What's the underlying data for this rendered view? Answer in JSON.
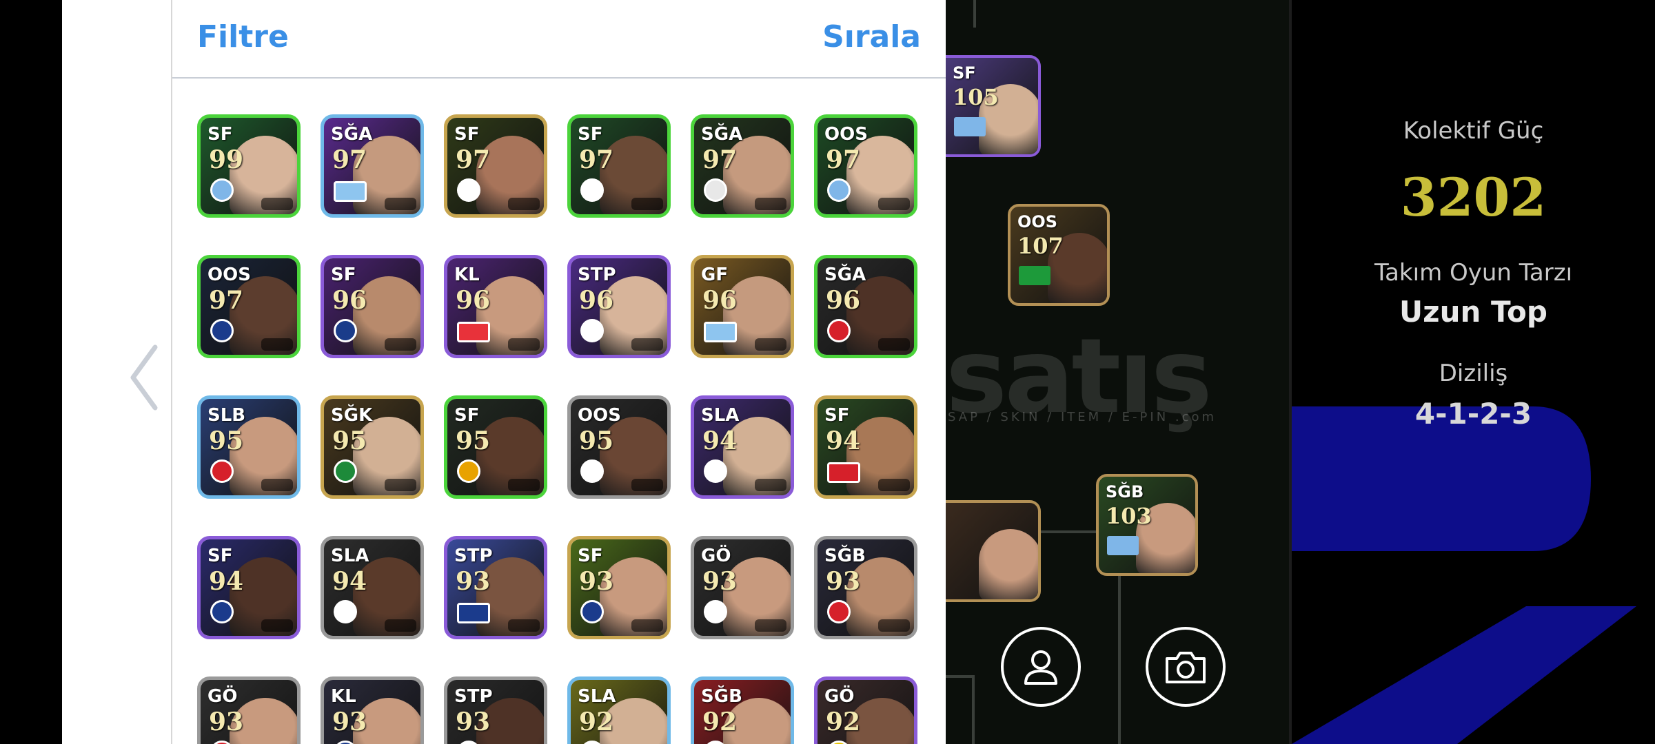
{
  "header": {
    "filter_label": "Filtre",
    "sort_label": "Sırala"
  },
  "players": [
    {
      "pos": "SF",
      "rating": "99",
      "frame": "#4bd43b",
      "bg": "#1e5a2c",
      "face": "#d7b49a",
      "crest": "#7fb6e8",
      "crest_type": "badge"
    },
    {
      "pos": "SĞA",
      "rating": "97",
      "frame": "#6fb9e8",
      "bg": "#5a2a8e",
      "face": "#c59a7e",
      "crest": "#8ec5ef",
      "crest_type": "flag"
    },
    {
      "pos": "SF",
      "rating": "97",
      "frame": "#c7a54f",
      "bg": "#2f3a18",
      "face": "#a8745a",
      "crest": "#ffffff",
      "crest_type": "badge"
    },
    {
      "pos": "SF",
      "rating": "97",
      "frame": "#4bd43b",
      "bg": "#1f4a26",
      "face": "#6b4a36",
      "crest": "#ffffff",
      "crest_type": "badge"
    },
    {
      "pos": "SĞA",
      "rating": "97",
      "frame": "#4bd43b",
      "bg": "#23361e",
      "face": "#c59a7e",
      "crest": "#e8e8e8",
      "crest_type": "badge"
    },
    {
      "pos": "OOS",
      "rating": "97",
      "frame": "#4bd43b",
      "bg": "#1d4a24",
      "face": "#d9b79c",
      "crest": "#7fb6e8",
      "crest_type": "badge"
    },
    {
      "pos": "OOS",
      "rating": "97",
      "frame": "#4bd43b",
      "bg": "#1a2438",
      "face": "#5c3d2e",
      "crest": "#1b3b8c",
      "crest_type": "badge"
    },
    {
      "pos": "SF",
      "rating": "96",
      "frame": "#8a5bd8",
      "bg": "#4a2270",
      "face": "#b88a6c",
      "crest": "#1a3c8a",
      "crest_type": "badge"
    },
    {
      "pos": "KL",
      "rating": "96",
      "frame": "#8a5bd8",
      "bg": "#4c2472",
      "face": "#c89a7e",
      "crest": "#e8323a",
      "crest_type": "flag"
    },
    {
      "pos": "STP",
      "rating": "96",
      "frame": "#8a5bd8",
      "bg": "#4a2a82",
      "face": "#d7b49a",
      "crest": "#ffffff",
      "crest_type": "badge"
    },
    {
      "pos": "GF",
      "rating": "96",
      "frame": "#c7a54f",
      "bg": "#7a5a22",
      "face": "#c59a7e",
      "crest": "#8ec5ef",
      "crest_type": "flag"
    },
    {
      "pos": "SĞA",
      "rating": "96",
      "frame": "#4bd43b",
      "bg": "#2a2a2a",
      "face": "#4e3226",
      "crest": "#d6202a",
      "crest_type": "badge"
    },
    {
      "pos": "SLB",
      "rating": "95",
      "frame": "#6fb9e8",
      "bg": "#2a3e74",
      "face": "#c89a7e",
      "crest": "#d6202a",
      "crest_type": "badge"
    },
    {
      "pos": "SĞK",
      "rating": "95",
      "frame": "#c7a54f",
      "bg": "#4a3a1e",
      "face": "#d2b094",
      "crest": "#1d8a3a",
      "crest_type": "badge"
    },
    {
      "pos": "SF",
      "rating": "95",
      "frame": "#4bd43b",
      "bg": "#222a22",
      "face": "#5a3a2a",
      "crest": "#e8a200",
      "crest_type": "badge"
    },
    {
      "pos": "OOS",
      "rating": "95",
      "frame": "#9a9a9a",
      "bg": "#2a2a2a",
      "face": "#6a4634",
      "crest": "#ffffff",
      "crest_type": "badge"
    },
    {
      "pos": "SLA",
      "rating": "94",
      "frame": "#8a5bd8",
      "bg": "#3e2a6e",
      "face": "#d2b094",
      "crest": "#ffffff",
      "crest_type": "badge"
    },
    {
      "pos": "SF",
      "rating": "94",
      "frame": "#c7a54f",
      "bg": "#2a4a22",
      "face": "#a87856",
      "crest": "#d6202a",
      "crest_type": "flag"
    },
    {
      "pos": "SF",
      "rating": "94",
      "frame": "#8a5bd8",
      "bg": "#2a2a6a",
      "face": "#4e3226",
      "crest": "#1b3b8c",
      "crest_type": "badge"
    },
    {
      "pos": "SLA",
      "rating": "94",
      "frame": "#9a9a9a",
      "bg": "#2e2e2e",
      "face": "#5a3a2a",
      "crest": "#ffffff",
      "crest_type": "badge"
    },
    {
      "pos": "STP",
      "rating": "93",
      "frame": "#8a5bd8",
      "bg": "#3a4a9a",
      "face": "#7a5440",
      "crest": "#1b3b8c",
      "crest_type": "flag"
    },
    {
      "pos": "SF",
      "rating": "93",
      "frame": "#c7a54f",
      "bg": "#4a6a1a",
      "face": "#c89a7e",
      "crest": "#1b3b8c",
      "crest_type": "badge"
    },
    {
      "pos": "GÖ",
      "rating": "93",
      "frame": "#9a9a9a",
      "bg": "#2e2e2e",
      "face": "#c89a7e",
      "crest": "#ffffff",
      "crest_type": "badge"
    },
    {
      "pos": "SĞB",
      "rating": "93",
      "frame": "#9a9a9a",
      "bg": "#2a2a3a",
      "face": "#b88a6c",
      "crest": "#d6202a",
      "crest_type": "badge"
    },
    {
      "pos": "GÖ",
      "rating": "93",
      "frame": "#9a9a9a",
      "bg": "#2e2e2e",
      "face": "#c89a7e",
      "crest": "#d6202a",
      "crest_type": "badge"
    },
    {
      "pos": "KL",
      "rating": "93",
      "frame": "#9a9a9a",
      "bg": "#2a2a3a",
      "face": "#c89a7e",
      "crest": "#1b3b8c",
      "crest_type": "badge"
    },
    {
      "pos": "STP",
      "rating": "93",
      "frame": "#9a9a9a",
      "bg": "#2a2a2a",
      "face": "#4e3226",
      "crest": "#ffffff",
      "crest_type": "badge"
    },
    {
      "pos": "SLA",
      "rating": "92",
      "frame": "#6fb9e8",
      "bg": "#6a6a1a",
      "face": "#d2b094",
      "crest": "#ffffff",
      "crest_type": "badge"
    },
    {
      "pos": "SĞB",
      "rating": "92",
      "frame": "#6fb9e8",
      "bg": "#8a1e22",
      "face": "#c89a7e",
      "crest": "#ffffff",
      "crest_type": "badge"
    },
    {
      "pos": "GÖ",
      "rating": "92",
      "frame": "#8a5bd8",
      "bg": "#3a2a2a",
      "face": "#7a5440",
      "crest": "#e8c400",
      "crest_type": "badge"
    }
  ],
  "pitch": {
    "cards": [
      {
        "pos": "SF",
        "rating": "105",
        "frame": "#8a5bd8",
        "bg": "#4a3a7a",
        "face": "#d2b094",
        "crest": "#7fb6e8"
      },
      {
        "pos": "OOS",
        "rating": "107",
        "frame": "#b39055",
        "bg": "#4a3a1e",
        "face": "#5a3a2a",
        "crest": "#1d9a3a"
      },
      {
        "pos": "SĞB",
        "rating": "103",
        "frame": "#b39055",
        "bg": "#2a4a22",
        "face": "#c89a7e",
        "crest": "#7fb6e8"
      },
      {
        "pos": "",
        "rating": "",
        "frame": "#b39055",
        "bg": "#3a2a1e",
        "face": "#c89a7e",
        "crest": ""
      }
    ],
    "watermark": "satış",
    "watermark_sub": "SAP / SKIN / ITEM / E-PIN  .com"
  },
  "stats": {
    "team_strength_label": "Kolektif Güç",
    "team_strength_value": "3202",
    "playstyle_label": "Takım Oyun Tarzı",
    "playstyle_value": "Uzun Top",
    "formation_label": "Diziliş",
    "formation_value": "4-1-2-3"
  },
  "colors": {
    "accent_blue": "#3a8fe6",
    "strength_gold": "#c8be3a",
    "bg_deep_blue": "#0d0d8a"
  }
}
